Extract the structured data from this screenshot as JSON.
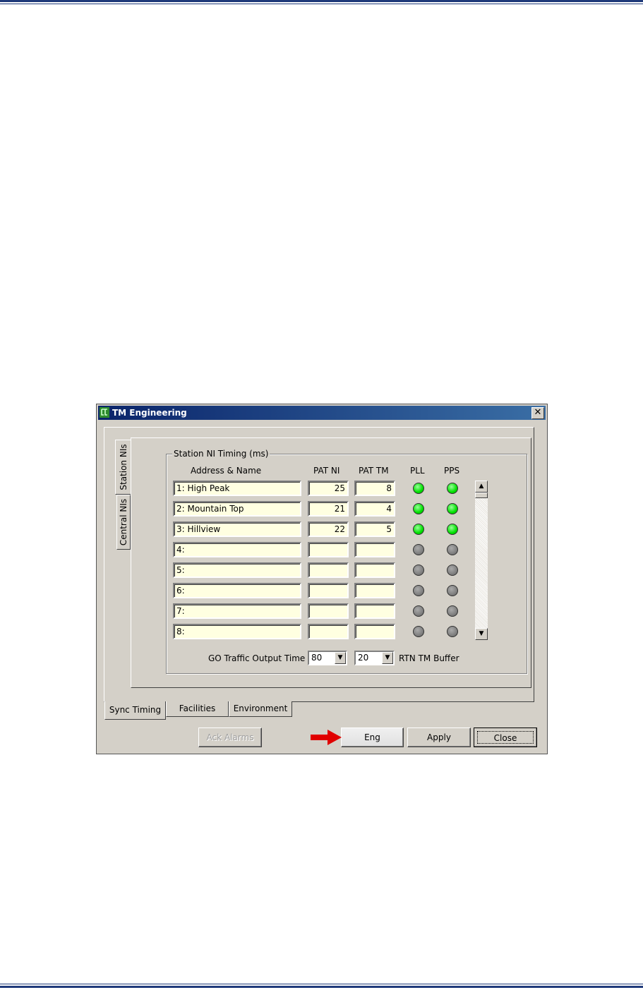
{
  "window": {
    "title": "TM Engineering",
    "close_glyph": "✕"
  },
  "side_tabs": {
    "station": "Station NIs",
    "central": "Central NIs"
  },
  "group": {
    "legend": "Station NI Timing (ms)",
    "columns": {
      "address": "Address & Name",
      "pat_ni": "PAT NI",
      "pat_tm": "PAT TM",
      "pll": "PLL",
      "pps": "PPS"
    },
    "rows": [
      {
        "name": "1:  High Peak",
        "pat_ni": "25",
        "pat_tm": "8",
        "pll": "on",
        "pps": "on"
      },
      {
        "name": "2:  Mountain Top",
        "pat_ni": "21",
        "pat_tm": "4",
        "pll": "on",
        "pps": "on"
      },
      {
        "name": "3:  Hillview",
        "pat_ni": "22",
        "pat_tm": "5",
        "pll": "on",
        "pps": "on"
      },
      {
        "name": "4:",
        "pat_ni": "",
        "pat_tm": "",
        "pll": "off",
        "pps": "off"
      },
      {
        "name": "5:",
        "pat_ni": "",
        "pat_tm": "",
        "pll": "off",
        "pps": "off"
      },
      {
        "name": "6:",
        "pat_ni": "",
        "pat_tm": "",
        "pll": "off",
        "pps": "off"
      },
      {
        "name": "7:",
        "pat_ni": "",
        "pat_tm": "",
        "pll": "off",
        "pps": "off"
      },
      {
        "name": "8:",
        "pat_ni": "",
        "pat_tm": "",
        "pll": "off",
        "pps": "off"
      }
    ],
    "go_traffic_label": "GO Traffic Output Time",
    "go_traffic_value": "80",
    "rtn_buffer_value": "20",
    "rtn_buffer_label": "RTN TM Buffer"
  },
  "bottom_tabs": [
    "Sync Timing",
    "Facilities",
    "Environment"
  ],
  "buttons": {
    "ack_alarms": "Ack Alarms",
    "eng": "Eng",
    "apply": "Apply",
    "close": "Close"
  },
  "colors": {
    "led_on": "#00e000",
    "led_off": "#808080",
    "field_bg": "#ffffe1",
    "arrow": "#e00000",
    "rule": "#1f3a7a"
  }
}
